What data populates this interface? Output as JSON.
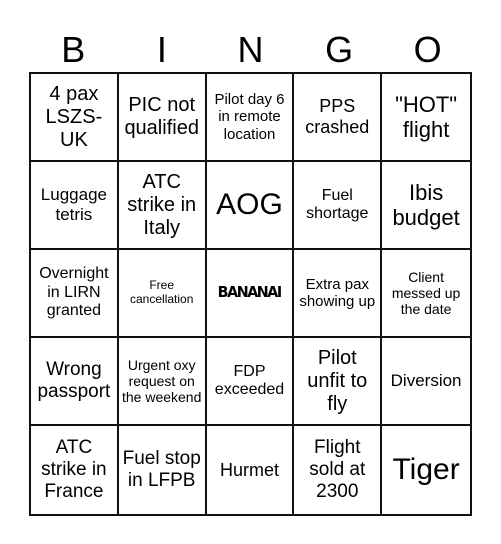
{
  "header": [
    "B",
    "I",
    "N",
    "G",
    "O"
  ],
  "cells": [
    [
      "4 pax LSZS-UK",
      "PIC not qualified",
      "Pilot day 6 in remote location",
      "PPS crashed",
      "\"HOT\" flight"
    ],
    [
      "Luggage tetris",
      "ATC strike in Italy",
      "AOG",
      "Fuel shortage",
      "Ibis budget"
    ],
    [
      "Overnight in LIRN granted",
      "Free cancellation",
      "BANANAI",
      "Extra pax showing up",
      "Client messed up the date"
    ],
    [
      "Wrong passport",
      "Urgent oxy request on the weekend",
      "FDP exceeded",
      "Pilot unfit to fly",
      "Diversion"
    ],
    [
      "ATC strike in France",
      "Fuel stop in LFPB",
      "Hurmet",
      "Flight sold at 2300",
      "Tiger"
    ]
  ]
}
